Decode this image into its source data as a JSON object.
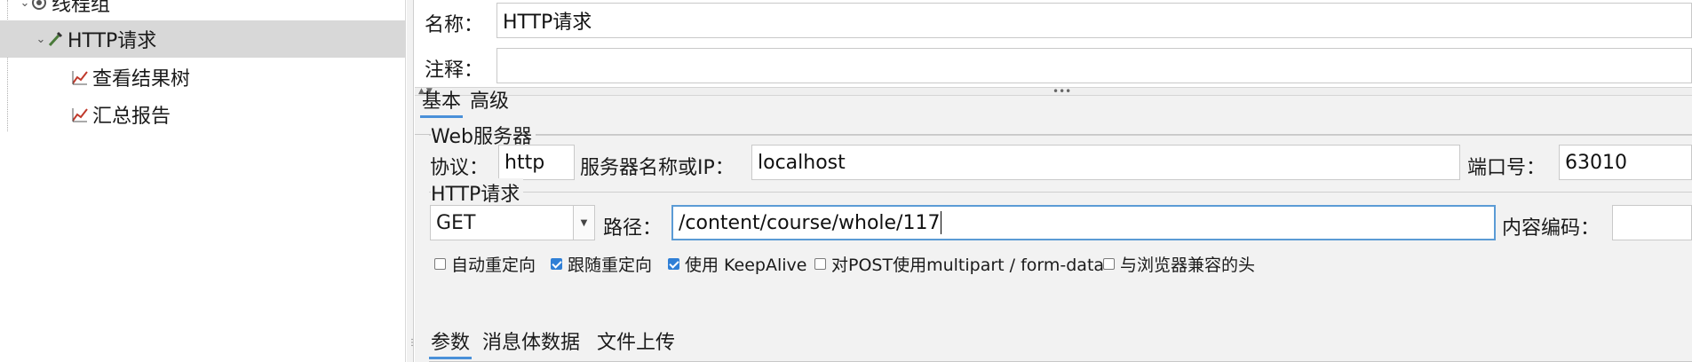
{
  "tree": {
    "items": [
      {
        "label": "线程组",
        "expanded": true,
        "icon": "thread-group-icon"
      },
      {
        "label": "HTTP请求",
        "expanded": true,
        "selected": true,
        "icon": "pipette-icon"
      },
      {
        "label": "查看结果树",
        "icon": "chart-icon"
      },
      {
        "label": "汇总报告",
        "icon": "chart-icon"
      }
    ]
  },
  "form": {
    "name_label": "名称：",
    "name_value": "HTTP请求",
    "comment_label": "注释：",
    "comment_value": ""
  },
  "tabs": {
    "basic": "基本",
    "advanced": "高级"
  },
  "web_server": {
    "title": "Web服务器",
    "protocol_label": "协议：",
    "protocol_value": "http",
    "server_label": "服务器名称或IP：",
    "server_value": "localhost",
    "port_label": "端口号：",
    "port_value": "63010"
  },
  "http_request": {
    "title": "HTTP请求",
    "method": "GET",
    "path_label": "路径：",
    "path_value": "/content/course/whole/117",
    "encoding_label": "内容编码：",
    "encoding_value": ""
  },
  "options": [
    {
      "label": "自动重定向",
      "checked": false
    },
    {
      "label": "跟随重定向",
      "checked": true
    },
    {
      "label": "使用 KeepAlive",
      "checked": true
    },
    {
      "label": "对POST使用multipart / form-data",
      "checked": false
    },
    {
      "label": "与浏览器兼容的头",
      "checked": false
    }
  ],
  "bottom_tabs": {
    "params": "参数",
    "body": "消息体数据",
    "files": "文件上传"
  },
  "colors": {
    "selection": "#d8d8d8",
    "accent": "#4a90d9",
    "checkbox": "#2f7fd6",
    "panel_bg": "#f2f2f2"
  }
}
